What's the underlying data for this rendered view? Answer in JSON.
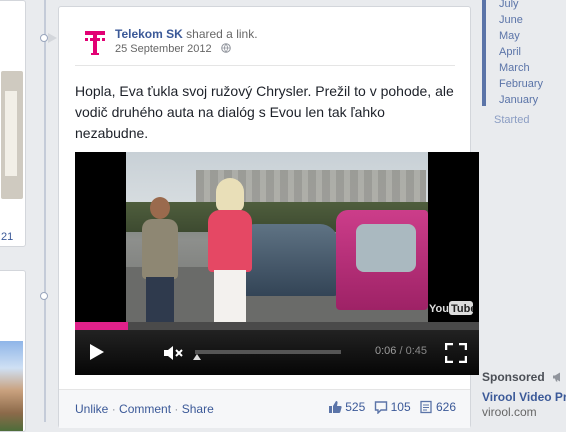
{
  "post": {
    "author": "Telekom SK",
    "action": "shared a link.",
    "date": "25 September 2012",
    "text": "Hopla, Eva ťukla svoj ružový Chrysler. Prežil to v pohode, ale vodič druhého auta na dialóg s Evou len tak ľahko nezabudne.",
    "brand_color": "#e20074"
  },
  "video": {
    "watermark": "YouTube",
    "current_time": "0:06",
    "separator": "/",
    "duration": "0:45",
    "progress_fraction": 0.13,
    "progress_color": "#e0218a",
    "icons": [
      "play-icon",
      "mute-icon",
      "fullscreen-icon"
    ]
  },
  "footer": {
    "unlike": "Unlike",
    "comment": "Comment",
    "share": "Share",
    "sep": "·",
    "likes": "525",
    "comments": "105",
    "shares": "626"
  },
  "left": {
    "number": "21"
  },
  "sidebar": {
    "months": [
      "July",
      "June",
      "May",
      "April",
      "March",
      "February",
      "January"
    ],
    "started": "Started",
    "sponsored": "Sponsored",
    "ad_title": "Virool Video Pr",
    "ad_url": "virool.com"
  }
}
